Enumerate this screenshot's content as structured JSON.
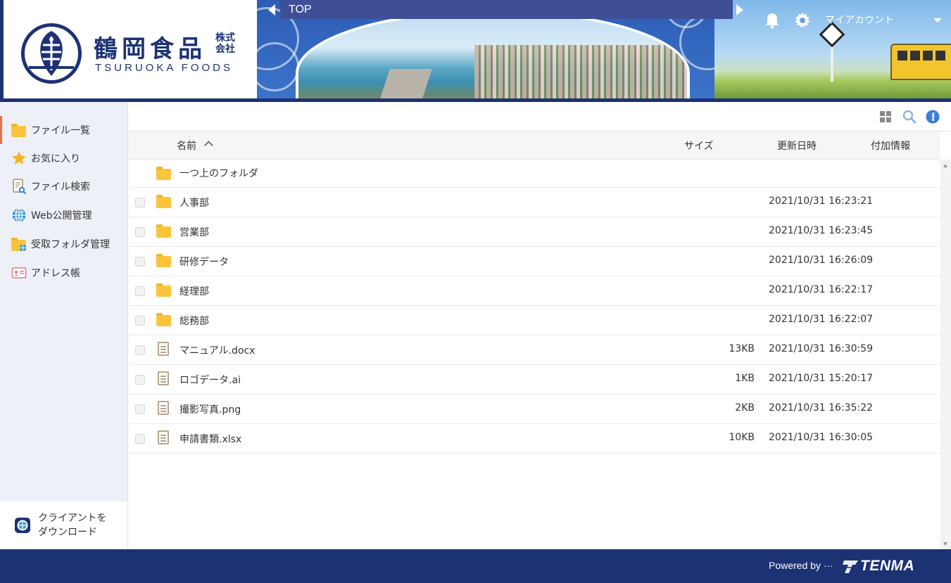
{
  "header": {
    "logo": {
      "kanji": "鶴岡食品",
      "suffix": "株式会社",
      "roman": "TSURUOKA FOODS"
    },
    "path": "TOP",
    "account_label": "マイアカウント"
  },
  "sidebar": {
    "items": [
      {
        "label": "ファイル一覧",
        "icon": "folder-icon"
      },
      {
        "label": "お気に入り",
        "icon": "star-icon"
      },
      {
        "label": "ファイル検索",
        "icon": "file-search-icon"
      },
      {
        "label": "Web公開管理",
        "icon": "globe-icon"
      },
      {
        "label": "受取フォルダ管理",
        "icon": "folder-globe-icon"
      },
      {
        "label": "アドレス帳",
        "icon": "address-card-icon"
      }
    ],
    "download_label_1": "クライアントを",
    "download_label_2": "ダウンロード"
  },
  "columns": {
    "name": "名前",
    "size": "サイズ",
    "updated": "更新日時",
    "extra": "付加情報"
  },
  "parent_folder": "一つ上のフォルダ",
  "files": [
    {
      "type": "folder",
      "name": "人事部",
      "size": "",
      "updated": "2021/10/31 16:23:21"
    },
    {
      "type": "folder",
      "name": "営業部",
      "size": "",
      "updated": "2021/10/31 16:23:45"
    },
    {
      "type": "folder",
      "name": "研修データ",
      "size": "",
      "updated": "2021/10/31 16:26:09"
    },
    {
      "type": "folder",
      "name": "経理部",
      "size": "",
      "updated": "2021/10/31 16:22:17"
    },
    {
      "type": "folder",
      "name": "総務部",
      "size": "",
      "updated": "2021/10/31 16:22:07"
    },
    {
      "type": "file",
      "name": "マニュアル.docx",
      "size": "13KB",
      "updated": "2021/10/31 16:30:59"
    },
    {
      "type": "file",
      "name": "ロゴデータ.ai",
      "size": "1KB",
      "updated": "2021/10/31 15:20:17"
    },
    {
      "type": "file",
      "name": "撮影写真.png",
      "size": "2KB",
      "updated": "2021/10/31 16:35:22"
    },
    {
      "type": "file",
      "name": "申請書類.xlsx",
      "size": "10KB",
      "updated": "2021/10/31 16:30:05"
    }
  ],
  "footer": {
    "powered_by": "Powered by ···",
    "brand": "TENMA"
  },
  "colors": {
    "brand_navy": "#1d3275",
    "folder_yellow": "#fbc43d",
    "active_accent": "#e8704e",
    "info_blue": "#3b7dd8"
  }
}
